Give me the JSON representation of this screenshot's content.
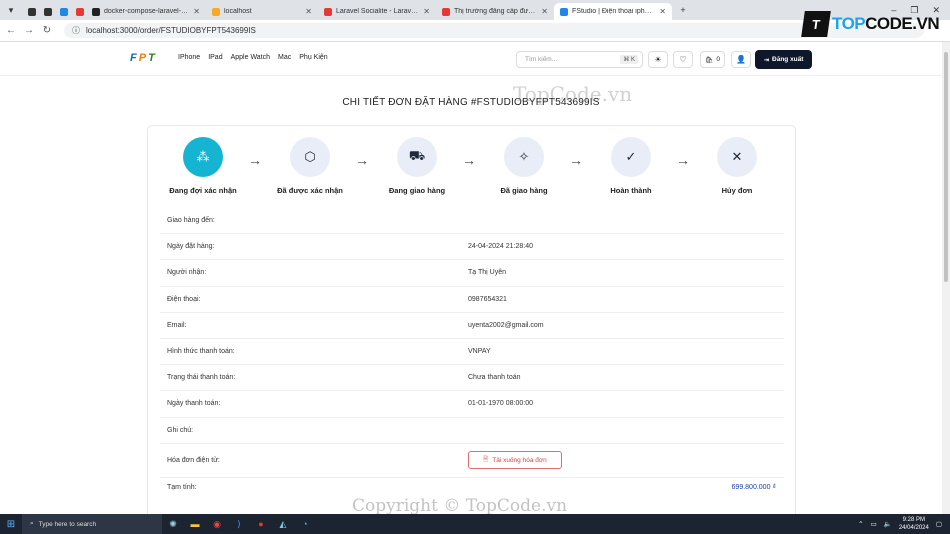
{
  "browser": {
    "tabs": [
      {
        "label": "",
        "color": "#333"
      },
      {
        "label": "",
        "color": "#333"
      },
      {
        "label": "",
        "color": "#1e88e5"
      },
      {
        "label": "",
        "color": "#e53935"
      },
      {
        "label": "docker-compose-laravel-alpin",
        "color": "#222"
      },
      {
        "label": "localhost",
        "color": "#f9a825"
      },
      {
        "label": "Laravel Socialite - Laravel 11.x",
        "color": "#e53935"
      },
      {
        "label": "Thị trường đẳng cấp được cả t",
        "color": "#e53935"
      },
      {
        "label": "FStudio | Điện thoại iphone ch",
        "color": "#1e88e5"
      }
    ],
    "url": "localhost:3000/order/FSTUDIOBYFPT543699IS"
  },
  "header": {
    "logo_letters": [
      "F",
      "P",
      "T"
    ],
    "logo_colors": [
      "#1565c0",
      "#f57c00",
      "#2e7d32"
    ],
    "menu": [
      "IPhone",
      "IPad",
      "Apple Watch",
      "Mac",
      "Phụ Kiện"
    ],
    "search_placeholder": "Tìm kiếm...",
    "search_shortcut": "⌘ K",
    "cart_count": "0",
    "logout_label": "Đăng xuất"
  },
  "page": {
    "title": "CHI TIẾT ĐƠN ĐẶT HÀNG #FSTUDIOBYFPT543699IS",
    "steps": [
      {
        "label": "Đang đợi xác nhận",
        "icon": "loader-icon",
        "active": true
      },
      {
        "label": "Đã được xác nhận",
        "icon": "package-icon",
        "active": false
      },
      {
        "label": "Đang giao hàng",
        "icon": "truck-icon",
        "active": false
      },
      {
        "label": "Đã giao hàng",
        "icon": "party-icon",
        "active": false
      },
      {
        "label": "Hoàn thành",
        "icon": "check-icon",
        "active": false
      },
      {
        "label": "Hủy đơn",
        "icon": "x-icon",
        "active": false
      }
    ],
    "details": [
      {
        "label": "Giao hàng đến:",
        "value": ""
      },
      {
        "label": "Ngày đặt hàng:",
        "value": "24-04-2024 21:28:40"
      },
      {
        "label": "Người nhận:",
        "value": "Tạ Thị Uyên"
      },
      {
        "label": "Điện thoại:",
        "value": "0987654321"
      },
      {
        "label": "Email:",
        "value": "uyenta2002@gmail.com"
      },
      {
        "label": "Hình thức thanh toán:",
        "value": "VNPAY"
      },
      {
        "label": "Trạng thái thanh toán:",
        "value": "Chưa thanh toán"
      },
      {
        "label": "Ngày thanh toán:",
        "value": "01-01-1970 08:00:00"
      },
      {
        "label": "Ghi chú:",
        "value": ""
      }
    ],
    "invoice_label": "Hóa đơn điện tử:",
    "download_label": "Tải xuống hóa đơn",
    "subtotal_label": "Tạm tính:",
    "subtotal_value": "699.800.000 ₫"
  },
  "watermarks": {
    "top": "TopCode.vn",
    "bottom": "Copyright © TopCode.vn",
    "brand_box": "T",
    "brand_text_a": "TOP",
    "brand_text_b": "CODE.VN"
  },
  "taskbar": {
    "search_placeholder": "Type here to search",
    "time": "9:28 PM",
    "date": "24/04/2024"
  }
}
